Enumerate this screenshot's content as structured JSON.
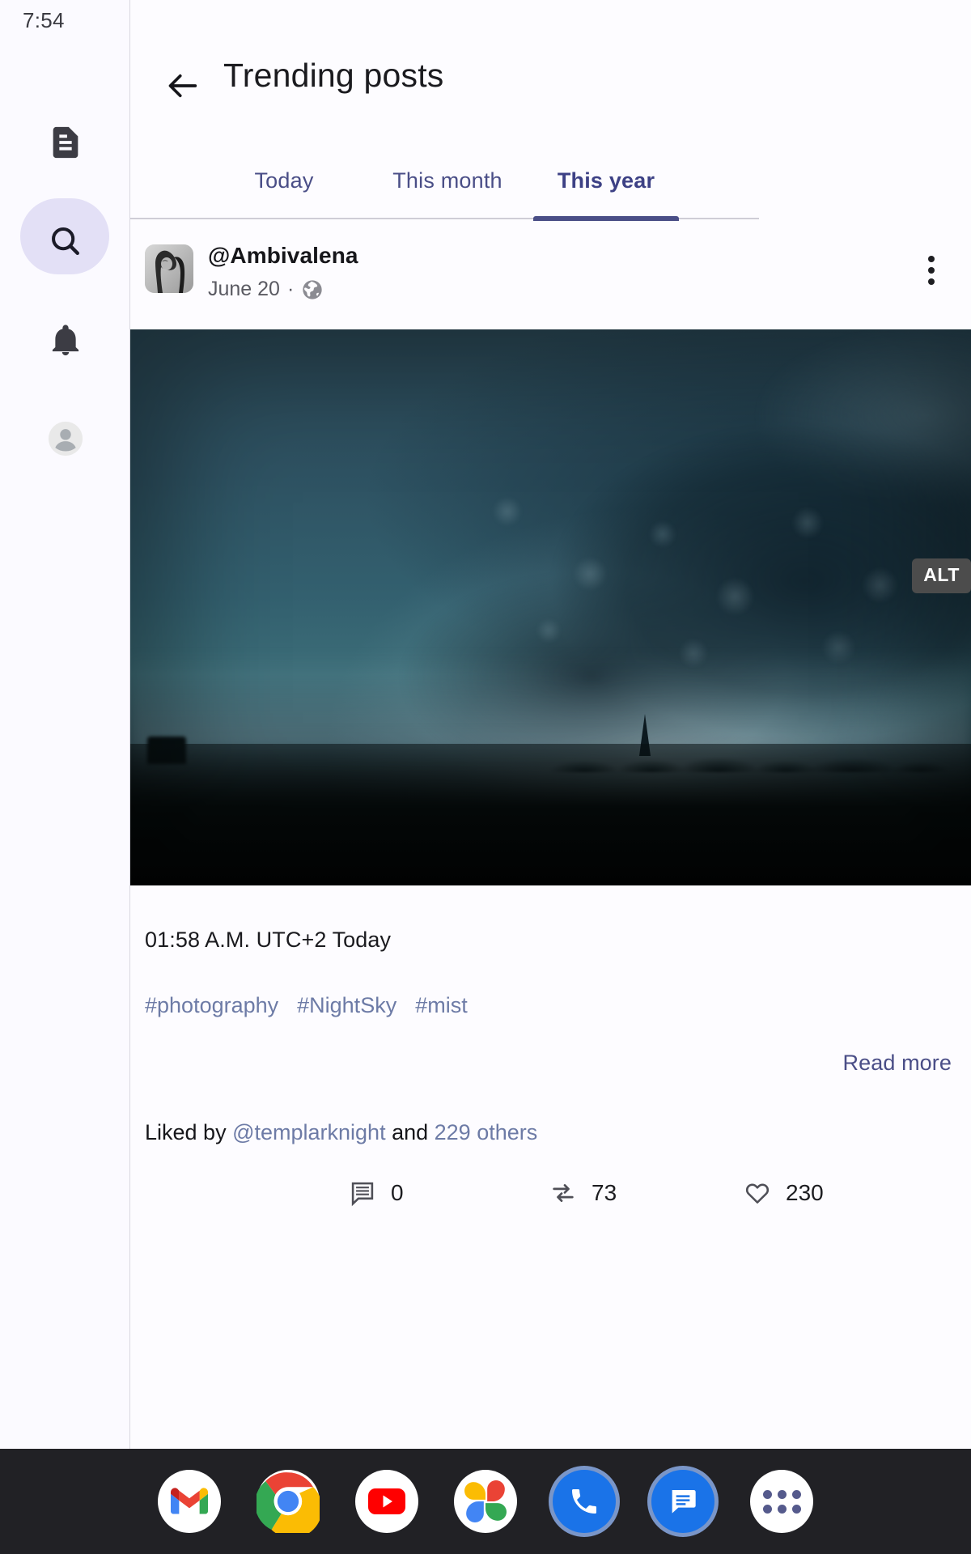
{
  "status_bar": {
    "time": "7:54",
    "icons": [
      "wifi-icon",
      "cellular-signal-icon",
      "battery-icon"
    ]
  },
  "sidebar": {
    "items": [
      {
        "name": "feed",
        "icon": "document-icon",
        "active": false
      },
      {
        "name": "search",
        "icon": "search-icon",
        "active": true
      },
      {
        "name": "notifications",
        "icon": "bell-icon",
        "active": false
      },
      {
        "name": "profile",
        "icon": "account-avatar-icon",
        "active": false
      }
    ]
  },
  "app_bar": {
    "back_icon": "arrow-left-icon",
    "title": "Trending posts"
  },
  "tabs": {
    "items": [
      {
        "label": "Today",
        "active": false
      },
      {
        "label": "This month",
        "active": false
      },
      {
        "label": "This year",
        "active": true
      }
    ],
    "selected": "This year"
  },
  "post": {
    "author": "@Ambivalena",
    "date": "June 20",
    "separator": "·",
    "visibility_icon": "globe-public-icon",
    "menu_icon": "more-vert-icon",
    "avatar_alt": "portrait-avatar",
    "media": {
      "alt_badge": "ALT",
      "description": "dark storm clouds over a misty field at dusk"
    },
    "time_text": "01:58 A.M. UTC+2 Today",
    "hashtags": [
      "#photography",
      "#NightSky",
      "#mist"
    ],
    "read_more": "Read more",
    "liked_by": {
      "prefix": "Liked by ",
      "user": "@templarknight",
      "middle": " and ",
      "others": "229 others"
    },
    "actions": [
      {
        "name": "comment",
        "icon": "comment-icon",
        "count": "0"
      },
      {
        "name": "repost",
        "icon": "repost-icon",
        "count": "73"
      },
      {
        "name": "like",
        "icon": "heart-icon",
        "count": "230"
      },
      {
        "name": "bookmark",
        "icon": "bookmark-icon",
        "count": ""
      }
    ]
  },
  "taskbar": {
    "apps": [
      {
        "name": "gmail",
        "label": "Gmail"
      },
      {
        "name": "chrome",
        "label": "Chrome"
      },
      {
        "name": "youtube",
        "label": "YouTube"
      },
      {
        "name": "photos",
        "label": "Photos"
      },
      {
        "name": "phone",
        "label": "Phone"
      },
      {
        "name": "messages",
        "label": "Messages"
      },
      {
        "name": "all-apps",
        "label": "All apps"
      }
    ]
  },
  "colors": {
    "accent": "#4a4e87",
    "link": "#6d7ba6",
    "background": "#fdfcff",
    "rail_active_pill": "#e3e0f6",
    "taskbar": "#212125"
  }
}
